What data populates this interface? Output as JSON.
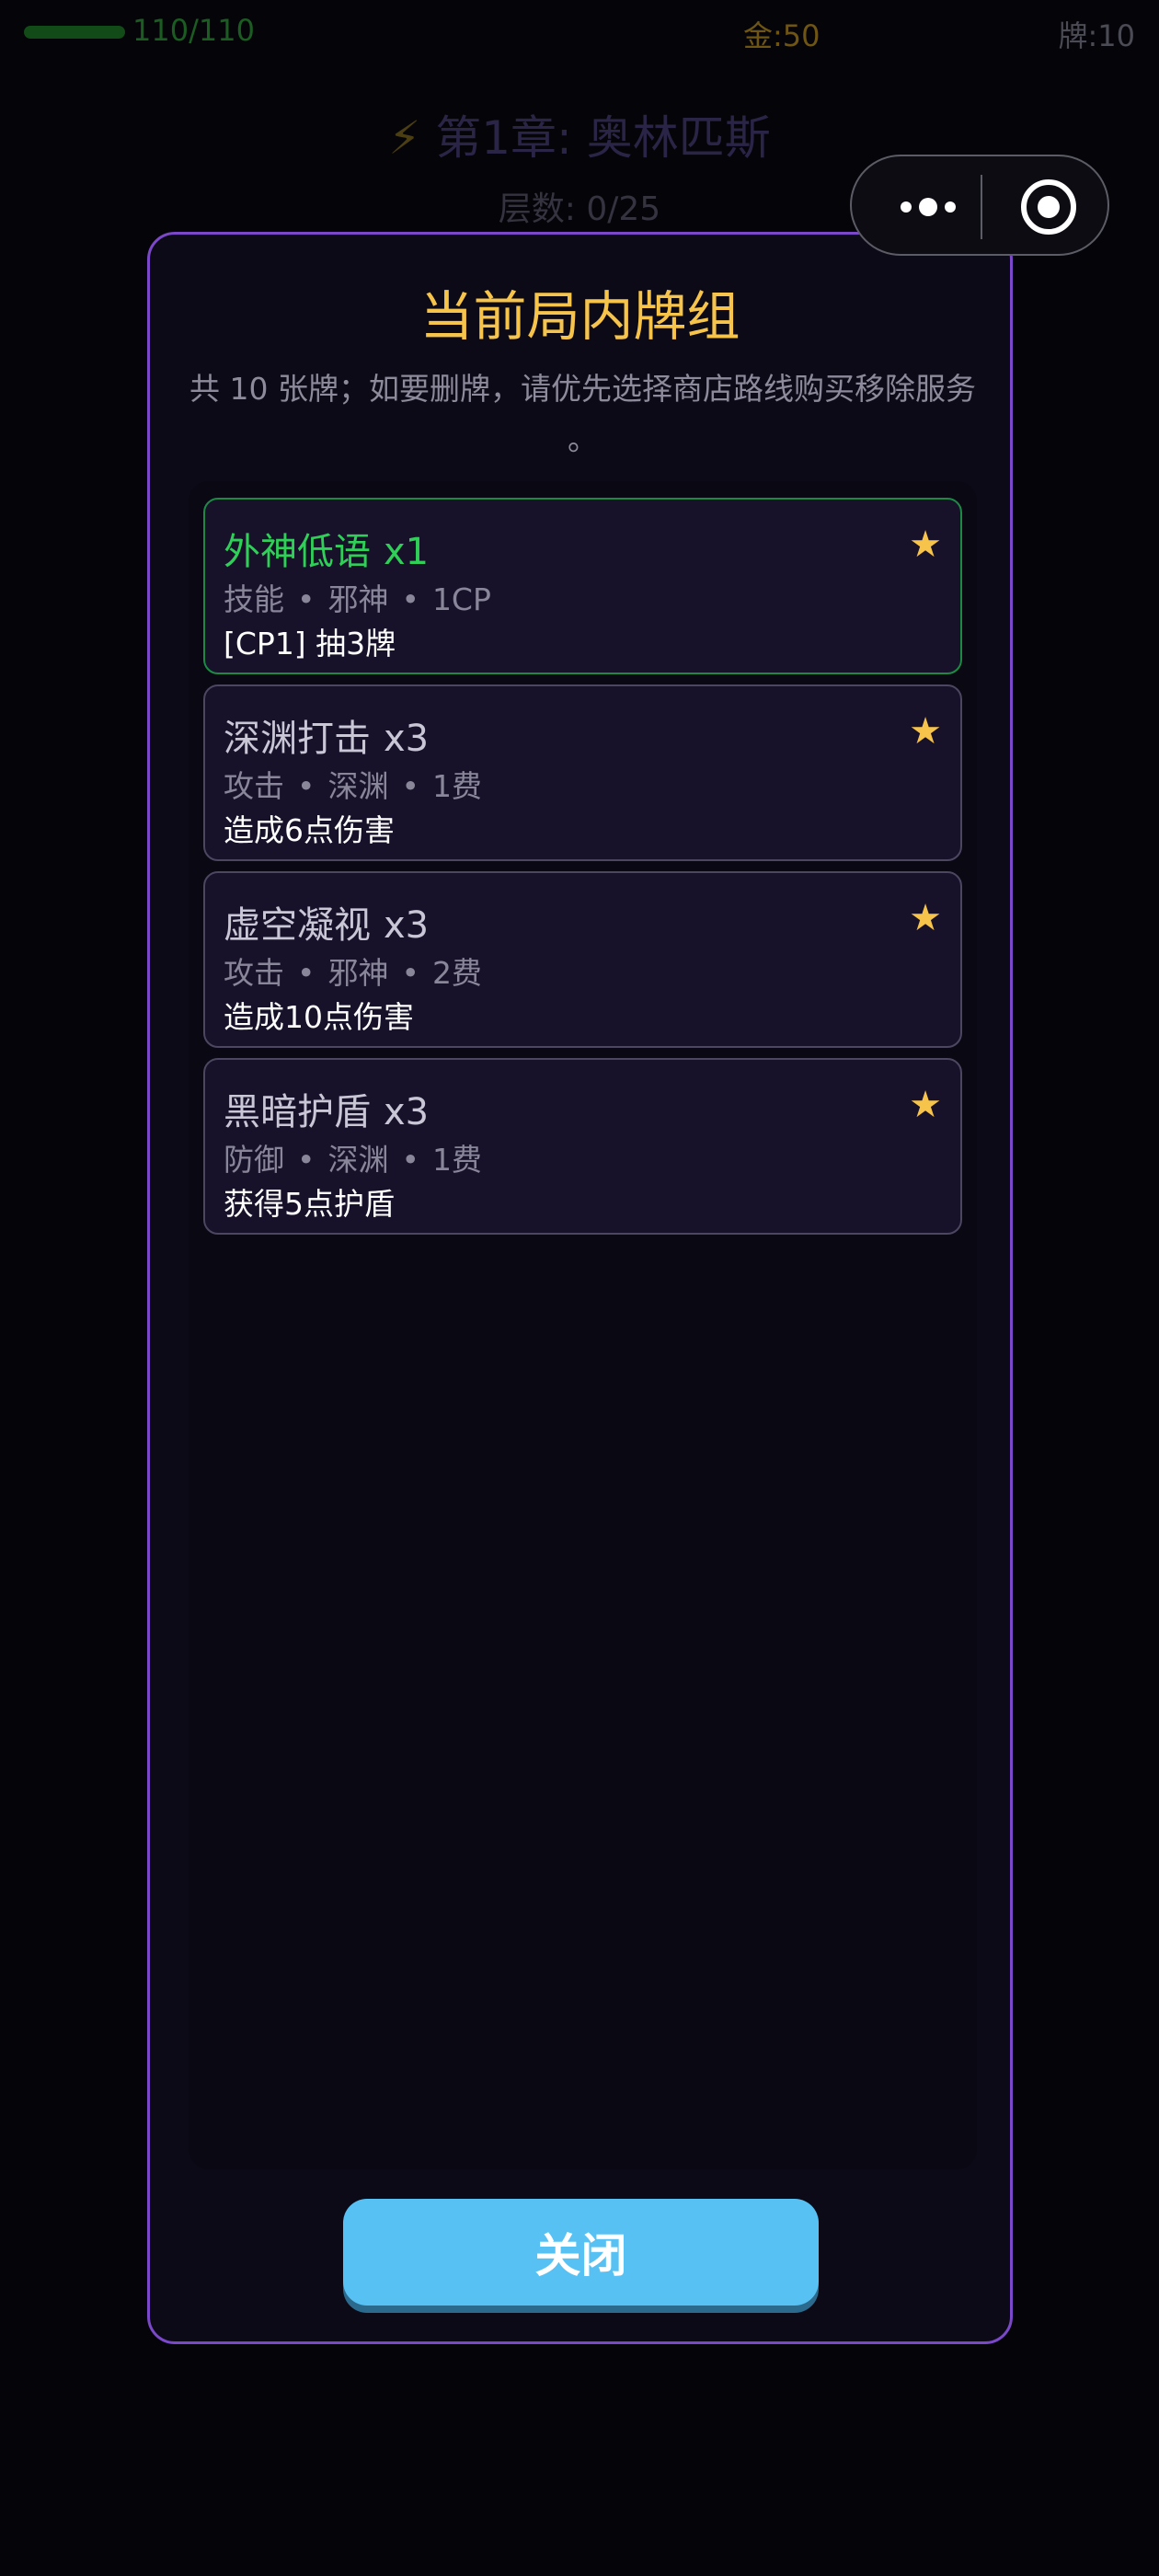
{
  "hud": {
    "hp_text": "110/110",
    "hp_fraction": 1.0,
    "gold_text": "金:50",
    "cards_text": "牌:10"
  },
  "chapter": {
    "icon": "lightning-icon",
    "title": "第1章: 奥林匹斯",
    "floor": "层数: 0/25"
  },
  "capsule": {
    "menu_icon": "more-dots-icon",
    "close_icon": "target-circle-icon"
  },
  "modal": {
    "title": "当前局内牌组",
    "subtitle": "共 10 张牌；如要删牌，请优先选择商店路线购买移除服务 。",
    "close_label": "关闭",
    "cards": [
      {
        "name": "外神低语",
        "count": "x1",
        "type": "技能",
        "faction": "邪神",
        "cost": "1CP",
        "desc": "[CP1] 抽3牌",
        "star": "★",
        "highlight": true
      },
      {
        "name": "深渊打击",
        "count": "x3",
        "type": "攻击",
        "faction": "深渊",
        "cost": "1费",
        "desc": "造成6点伤害",
        "star": "★",
        "highlight": false
      },
      {
        "name": "虚空凝视",
        "count": "x3",
        "type": "攻击",
        "faction": "邪神",
        "cost": "2费",
        "desc": "造成10点伤害",
        "star": "★",
        "highlight": false
      },
      {
        "name": "黑暗护盾",
        "count": "x3",
        "type": "防御",
        "faction": "深渊",
        "cost": "1费",
        "desc": "获得5点护盾",
        "star": "★",
        "highlight": false
      }
    ]
  },
  "colors": {
    "accent_gold": "#f6c34b",
    "modal_border": "#7a48c8",
    "highlight_green": "#2fcf58",
    "button_blue": "#56c1f2"
  }
}
